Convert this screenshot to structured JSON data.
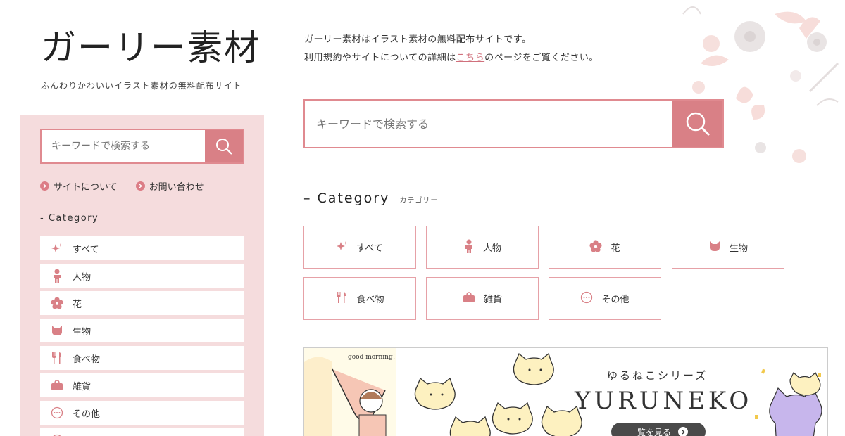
{
  "site": {
    "logo": "ガーリー素材",
    "tagline": "ふんわりかわいいイラスト素材の無料配布サイト"
  },
  "intro": {
    "line1": "ガーリー素材はイラスト素材の無料配布サイトです。",
    "line2_before": "利用規約やサイトについての詳細は",
    "line2_link": "こちら",
    "line2_after": "のページをご覧ください。"
  },
  "search": {
    "placeholder": "キーワードで検索する"
  },
  "sidebar": {
    "links": [
      {
        "label": "サイトについて"
      },
      {
        "label": "お問い合わせ"
      }
    ],
    "category_title": "- Category",
    "items": [
      {
        "label": "すべて",
        "icon": "sparkle-icon"
      },
      {
        "label": "人物",
        "icon": "person-icon"
      },
      {
        "label": "花",
        "icon": "flower-icon"
      },
      {
        "label": "生物",
        "icon": "cat-icon"
      },
      {
        "label": "食べ物",
        "icon": "cutlery-icon"
      },
      {
        "label": "雑貨",
        "icon": "bag-icon"
      },
      {
        "label": "その他",
        "icon": "dots-icon"
      },
      {
        "label": "",
        "icon": "more-icon"
      }
    ]
  },
  "category": {
    "title_en": "– Category",
    "title_jp": "カテゴリー",
    "cards": [
      {
        "label": "すべて",
        "icon": "sparkle-icon"
      },
      {
        "label": "人物",
        "icon": "person-icon"
      },
      {
        "label": "花",
        "icon": "flower-icon"
      },
      {
        "label": "生物",
        "icon": "cat-icon"
      },
      {
        "label": "食べ物",
        "icon": "cutlery-icon"
      },
      {
        "label": "雑貨",
        "icon": "bag-icon"
      },
      {
        "label": "その他",
        "icon": "dots-icon"
      }
    ]
  },
  "banner": {
    "subtitle": "ゆるねこシリーズ",
    "title": "YURUNEKO",
    "button": "一覧を見る",
    "speech": "good morning!"
  },
  "colors": {
    "accent": "#d98086",
    "sidebar_bg": "#f5dcdd",
    "border": "#e6a1a7"
  }
}
